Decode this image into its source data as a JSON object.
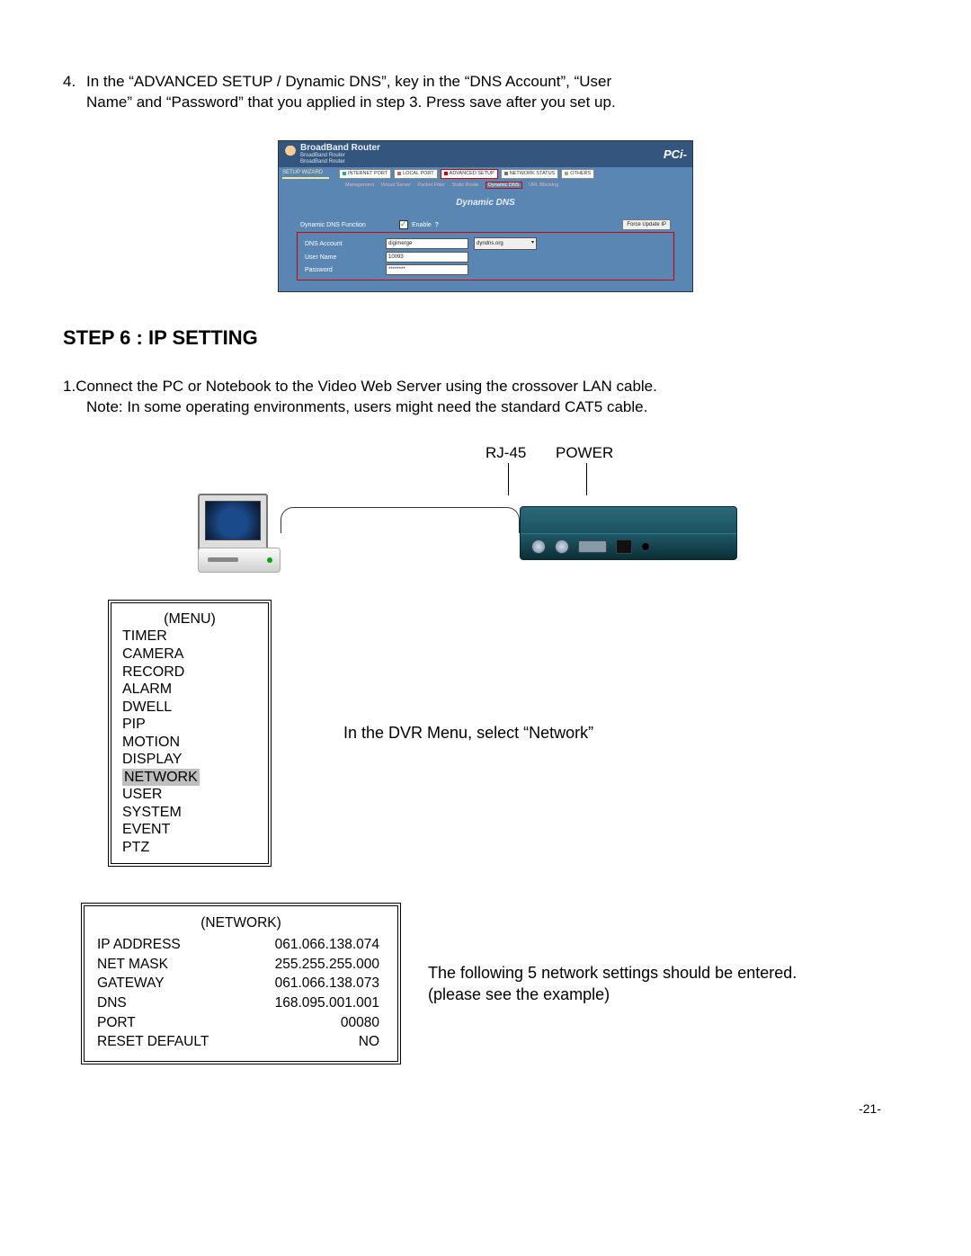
{
  "para4": {
    "num": "4.",
    "line1": "In the “ADVANCED SETUP / Dynamic DNS”, key in the  “DNS Account”, “User",
    "line2": "Name” and “Password” that you applied in step 3. Press save after you set up."
  },
  "router": {
    "title": "BroadBand Router",
    "sub1": "BroadBand Router",
    "sub2": "BroadBand Router",
    "pci": "PCi-",
    "wizard": "SETUP WIZARD",
    "tabs": {
      "internet": "INTERNET PORT",
      "local": "LOCAL PORT",
      "advanced": "ADVANCED SETUP",
      "status": "NETWORK STATUS",
      "others": "OTHERS"
    },
    "submenu": {
      "a": "Management",
      "b": "Virtual Server",
      "c": "Packet Filter",
      "d": "Static Route",
      "e": "Dynamic DNS",
      "f": "URL Blocking"
    },
    "caption": "Dynamic DNS",
    "fn_label": "Dynamic DNS Function",
    "enable": "Enable",
    "q": "?",
    "btn": "Force Update IP",
    "acct_label": "DNS Account",
    "user_label": "User Name",
    "pass_label": "Password",
    "acct_val": "digimerge",
    "domain_val": "dyndns.org",
    "user_val": "10093",
    "pass_val": "********"
  },
  "step6": "STEP 6 : IP SETTING",
  "para1": {
    "num": "1.",
    "line1": "Connect the PC or Notebook to the Video Web Server using the crossover LAN cable.",
    "line2": "Note: In some operating environments, users might need the standard CAT5 cable."
  },
  "fig": {
    "rj45": "RJ-45",
    "power": "POWER"
  },
  "menu": {
    "title": "(MENU)",
    "items": [
      "TIMER",
      "CAMERA",
      "RECORD",
      "ALARM",
      "DWELL",
      "PIP",
      "MOTION",
      "DISPLAY",
      "NETWORK",
      "USER",
      "SYSTEM",
      "EVENT",
      "PTZ"
    ],
    "caption": "In the DVR Menu, select “Network”"
  },
  "net": {
    "title": "(NETWORK)",
    "rows": [
      {
        "k": "IP ADDRESS",
        "v": "061.066.138.074"
      },
      {
        "k": "NET MASK",
        "v": "255.255.255.000"
      },
      {
        "k": "GATEWAY",
        "v": "061.066.138.073"
      },
      {
        "k": "DNS",
        "v": "168.095.001.001"
      },
      {
        "k": "PORT",
        "v": "00080"
      },
      {
        "k": "RESET DEFAULT",
        "v": "NO"
      }
    ],
    "caption1": "The following 5 network settings should be entered.",
    "caption2": "(please see the example)"
  },
  "page": "-21-"
}
